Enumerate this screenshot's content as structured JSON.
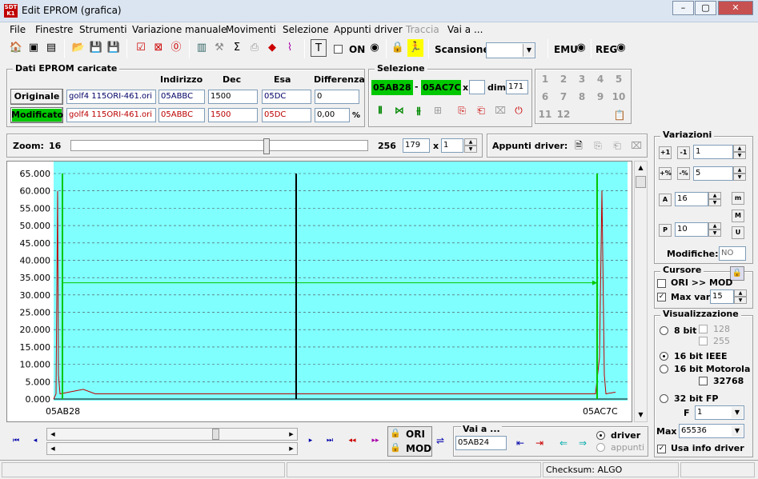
{
  "window": {
    "title": "Edit EPROM (grafica)",
    "app_icon_text": "SDT K1",
    "btn_min": "–",
    "btn_max": "▢",
    "btn_close": "✕"
  },
  "menu": [
    "File",
    "Finestre",
    "Strumenti",
    "Variazione manuale",
    "Movimenti",
    "Selezione",
    "Appunti driver",
    "Traccia",
    "Vai a ..."
  ],
  "toolbar": {
    "on_label": "ON",
    "scansione_label": "Scansione",
    "scansione_value": "",
    "emu_label": "EMU",
    "reg_label": "REG"
  },
  "eprom": {
    "group_title": "Dati EPROM caricate",
    "col_indirizzo": "Indirizzo",
    "col_dec": "Dec",
    "col_esa": "Esa",
    "col_diff": "Differenza",
    "originale_label": "Originale",
    "modificato_label": "Modificato",
    "orig_file": "golf4 115ORI-461.ori",
    "orig_addr": "05ABBC",
    "orig_dec": "1500",
    "orig_esa": "05DC",
    "orig_diff": "0",
    "mod_file": "golf4 115ORI-461.ori",
    "mod_addr": "05ABBC",
    "mod_dec": "1500",
    "mod_esa": "05DC",
    "mod_diff": "0,00",
    "percent": "%"
  },
  "selezione": {
    "title": "Selezione",
    "from": "05AB28",
    "dash": "-",
    "to": "05AC7C",
    "x": "x",
    "dim_label": "dim.",
    "dim_value": "171"
  },
  "numpad": [
    "1",
    "2",
    "3",
    "4",
    "5",
    "6",
    "7",
    "8",
    "9",
    "10",
    "11",
    "12"
  ],
  "zoom": {
    "label": "Zoom:",
    "min": "16",
    "max": "256",
    "value": "179",
    "x": "x",
    "mult": "1",
    "level": 0.66
  },
  "appunti": {
    "label": "Appunti driver:"
  },
  "chart_data": {
    "type": "line",
    "y_ticks": [
      "65.000",
      "60.000",
      "55.000",
      "50.000",
      "45.000",
      "40.000",
      "35.000",
      "30.000",
      "25.000",
      "20.000",
      "15.000",
      "10.000",
      "5.000",
      "0.000"
    ],
    "ylim": [
      0,
      65000
    ],
    "x_start_label": "05AB28",
    "x_end_label": "05AC7C",
    "cursor_value": 33500
  },
  "variazioni": {
    "title": "Variazioni",
    "v1": "1",
    "v2": "5",
    "v3": "16",
    "v4": "10",
    "modifiche_label": "Modifiche:",
    "modifiche_value": "NO"
  },
  "cursore": {
    "title": "Cursore",
    "ori_mod": "ORI >> MOD",
    "max_var_label": "Max var",
    "max_var_value": "15",
    "ori_mod_checked": "",
    "max_var_checked": "✓"
  },
  "visual": {
    "title": "Visualizzazione",
    "bit8": "8 bit",
    "v128": "128",
    "v255": "255",
    "ieee": "16 bit IEEE",
    "motorola": "16 bit Motorola",
    "v32768": "32768",
    "fp": "32 bit FP",
    "f_label": "F",
    "f_value": "1",
    "max_label": "Max",
    "max_value": "65536",
    "usa_info": "Usa info driver",
    "usa_info_checked": "✓"
  },
  "bottom": {
    "ori": "ORI",
    "mod": "MOD",
    "vai_label": "Vai a ...",
    "vai_value": "05AB24",
    "driver": "driver",
    "appunti": "appunti"
  },
  "status": {
    "checksum": "Checksum: ALGO"
  }
}
